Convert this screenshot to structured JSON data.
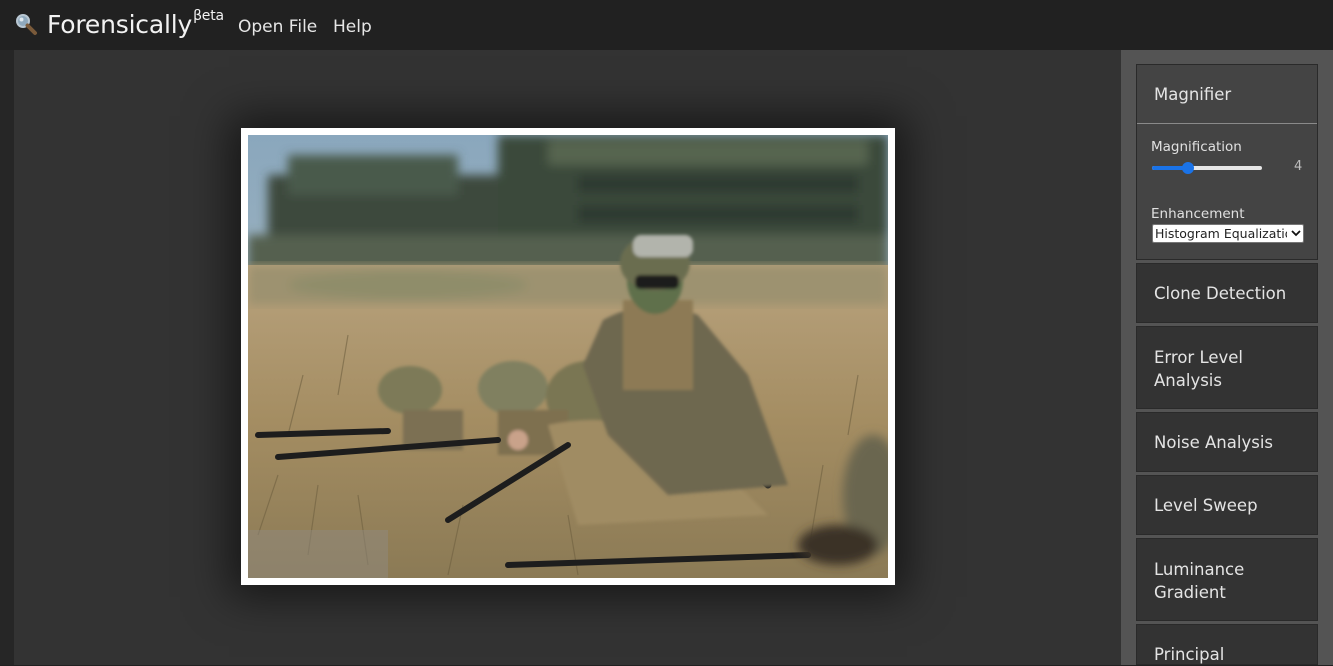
{
  "app": {
    "title": "Forensically",
    "badge": "βeta",
    "logo_icon": "magnifier-icon"
  },
  "menu": {
    "open_file": "Open File",
    "help": "Help"
  },
  "magnifier": {
    "title": "Magnifier",
    "magnification_label": "Magnification",
    "magnification_value": "4",
    "magnification_slider_fraction": 0.33,
    "enhancement_label": "Enhancement",
    "enhancement_selected": "Histogram Equalization"
  },
  "tools": [
    {
      "label": "Clone Detection"
    },
    {
      "label": "Error Level Analysis"
    },
    {
      "label": "Noise Analysis"
    },
    {
      "label": "Level Sweep"
    },
    {
      "label": "Luminance Gradient"
    },
    {
      "label": "Principal"
    }
  ],
  "colors": {
    "accent": "#1a73e8",
    "topbar": "#212121",
    "sidebar": "#545454",
    "panel": "#333333"
  }
}
